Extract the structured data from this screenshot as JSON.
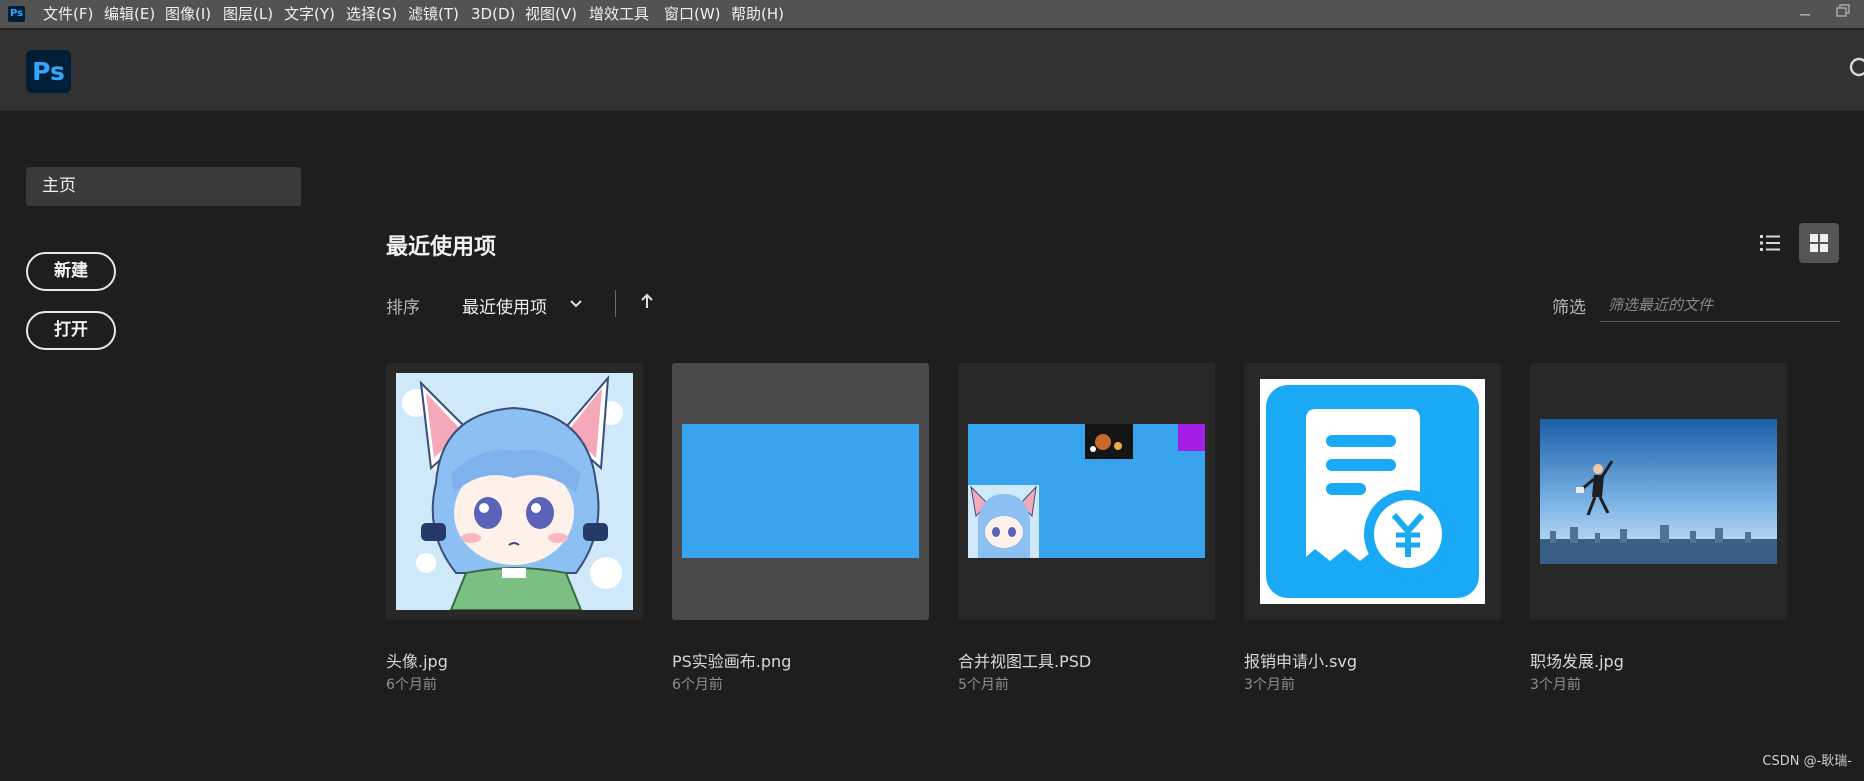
{
  "menubar": {
    "app_icon": "Ps",
    "items": [
      "文件(F)",
      "编辑(E)",
      "图像(I)",
      "图层(L)",
      "文字(Y)",
      "选择(S)",
      "滤镜(T)",
      "3D(D)",
      "视图(V)",
      "增效工具",
      "窗口(W)",
      "帮助(H)"
    ]
  },
  "header": {
    "logo": "Ps"
  },
  "sidebar": {
    "home_label": "主页",
    "new_label": "新建",
    "open_label": "打开"
  },
  "main": {
    "title": "最近使用项",
    "sort_label": "排序",
    "sort_value": "最近使用项",
    "filter_label": "筛选",
    "filter_placeholder": "筛选最近的文件",
    "files": [
      {
        "name": "头像.jpg",
        "time": "6个月前"
      },
      {
        "name": "PS实验画布.png",
        "time": "6个月前"
      },
      {
        "name": "合并视图工具.PSD",
        "time": "5个月前"
      },
      {
        "name": "报销申请小.svg",
        "time": "3个月前"
      },
      {
        "name": "职场发展.jpg",
        "time": "3个月前"
      }
    ]
  },
  "watermark": "CSDN @-耿瑞-",
  "colors": {
    "accent_blue": "#31a8ff",
    "canvas_blue": "#38a3ee",
    "receipt_blue": "#1aa9f5",
    "purple": "#a51ee6"
  }
}
